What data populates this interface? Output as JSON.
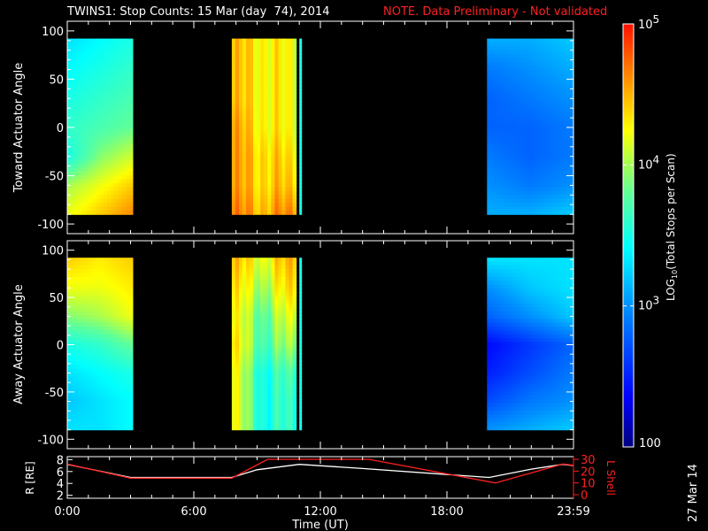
{
  "chart_data": [
    {
      "type": "heatmap",
      "title": "TWINS1: Stop Counts: 15 Mar (day  74), 2014",
      "note": "NOTE. Data Preliminary - Not validated",
      "ylabel": "Toward Actuator Angle",
      "ylim": [
        -110,
        110
      ],
      "yticks": [
        "100",
        "50",
        "0",
        "-50",
        "-100"
      ],
      "xlim_hours": [
        0,
        24
      ],
      "angles": [
        90,
        60,
        30,
        0,
        -30,
        -60,
        -88
      ],
      "segments": [
        {
          "t0": 0.0,
          "t1": 3.1,
          "log_values": [
            [
              3.3,
              3.4,
              3.5
            ],
            [
              3.4,
              3.5,
              3.6
            ],
            [
              3.5,
              3.6,
              3.7
            ],
            [
              3.6,
              3.7,
              3.8
            ],
            [
              3.5,
              3.9,
              4.1
            ],
            [
              4.0,
              4.2,
              4.4
            ],
            [
              4.2,
              4.4,
              4.6
            ]
          ]
        },
        {
          "t0": 7.8,
          "t1": 10.85,
          "log_values": [
            [
              4.4,
              4.3,
              4.2
            ],
            [
              4.4,
              4.3,
              4.2
            ],
            [
              4.4,
              4.3,
              4.2
            ],
            [
              4.5,
              4.3,
              4.2
            ],
            [
              4.5,
              4.4,
              4.3
            ],
            [
              4.5,
              4.4,
              4.4
            ],
            [
              4.6,
              4.5,
              4.6
            ]
          ]
        },
        {
          "t0": 11.0,
          "t1": 11.1,
          "log_values": [
            [
              3.5
            ],
            [
              3.5
            ],
            [
              3.5
            ],
            [
              3.5
            ],
            [
              3.5
            ],
            [
              3.5
            ],
            [
              3.5
            ]
          ]
        },
        {
          "t0": 19.9,
          "t1": 24.0,
          "log_values": [
            [
              3.1,
              3.1,
              3.2
            ],
            [
              2.9,
              3.0,
              3.1
            ],
            [
              2.8,
              2.9,
              3.0
            ],
            [
              2.8,
              2.8,
              2.9
            ],
            [
              2.9,
              2.8,
              2.9
            ],
            [
              3.0,
              2.9,
              3.0
            ],
            [
              3.1,
              3.1,
              3.2
            ]
          ]
        }
      ]
    },
    {
      "type": "heatmap",
      "ylabel": "Away Actuator Angle",
      "ylim": [
        -110,
        110
      ],
      "yticks": [
        "100",
        "50",
        "0",
        "-50",
        "-100"
      ],
      "xlim_hours": [
        0,
        24
      ],
      "angles": [
        90,
        60,
        30,
        0,
        -30,
        -60,
        -88
      ],
      "segments": [
        {
          "t0": 0.0,
          "t1": 3.1,
          "log_values": [
            [
              4.4,
              4.3,
              4.4
            ],
            [
              4.2,
              4.2,
              4.3
            ],
            [
              3.9,
              4.0,
              4.2
            ],
            [
              3.5,
              3.6,
              3.8
            ],
            [
              3.3,
              3.4,
              3.5
            ],
            [
              3.2,
              3.3,
              3.4
            ],
            [
              3.3,
              3.3,
              3.4
            ]
          ]
        },
        {
          "t0": 7.8,
          "t1": 10.85,
          "log_values": [
            [
              4.4,
              4.2,
              4.5
            ],
            [
              4.3,
              4.0,
              4.4
            ],
            [
              4.2,
              3.8,
              4.2
            ],
            [
              4.3,
              3.7,
              4.0
            ],
            [
              4.2,
              3.5,
              3.7
            ],
            [
              4.2,
              3.5,
              3.6
            ],
            [
              4.2,
              3.5,
              3.6
            ]
          ]
        },
        {
          "t0": 11.0,
          "t1": 11.1,
          "log_values": [
            [
              3.5
            ],
            [
              3.5
            ],
            [
              3.5
            ],
            [
              3.5
            ],
            [
              3.5
            ],
            [
              3.5
            ],
            [
              3.5
            ]
          ]
        },
        {
          "t0": 19.9,
          "t1": 24.0,
          "log_values": [
            [
              3.3,
              3.3,
              3.3
            ],
            [
              3.0,
              3.2,
              3.3
            ],
            [
              2.8,
              3.0,
              3.2
            ],
            [
              2.4,
              2.6,
              2.8
            ],
            [
              2.5,
              2.7,
              2.9
            ],
            [
              2.7,
              2.9,
              3.0
            ],
            [
              3.0,
              3.1,
              3.2
            ]
          ]
        }
      ]
    },
    {
      "type": "line",
      "ylabel": "R [RE]",
      "ylabel2": "L Shell",
      "ylim": [
        1.5,
        8.5
      ],
      "yticks": [
        "8",
        "6",
        "4",
        "2"
      ],
      "y2lim": [
        0,
        30
      ],
      "y2ticks": [
        "30",
        "20",
        "10",
        "0"
      ],
      "xlabel": "Time (UT)",
      "xticks": [
        "0:00",
        "6:00",
        "12:00",
        "18:00",
        "23:59"
      ],
      "series": [
        {
          "name": "R",
          "color": "#ffffff",
          "x": [
            0,
            3,
            7.8,
            9,
            11,
            14,
            20,
            22,
            23.5,
            24
          ],
          "y": [
            7.2,
            5.0,
            5.0,
            6.3,
            7.2,
            6.5,
            5.0,
            6.4,
            7.2,
            7.0
          ]
        },
        {
          "name": "L Shell",
          "color": "#ff2020",
          "x": [
            0,
            3,
            7.8,
            9.5,
            14.3,
            20.3,
            23.5,
            24
          ],
          "y": [
            26,
            14,
            14,
            30,
            30,
            10,
            26,
            25
          ]
        }
      ]
    }
  ],
  "colorbar": {
    "label": "LOG10(Total Stops per Scan)",
    "label_main": "LOG",
    "label_sub": "10",
    "label_rest": "(Total Stops per Scan)",
    "ticks": [
      {
        "base": "10",
        "exp": "5",
        "value": 5
      },
      {
        "base": "10",
        "exp": "4",
        "value": 4
      },
      {
        "base": "10",
        "exp": "3",
        "value": 3
      }
    ],
    "min_label": "100",
    "range": [
      2,
      5
    ]
  },
  "side_date": "27 Mar 14"
}
